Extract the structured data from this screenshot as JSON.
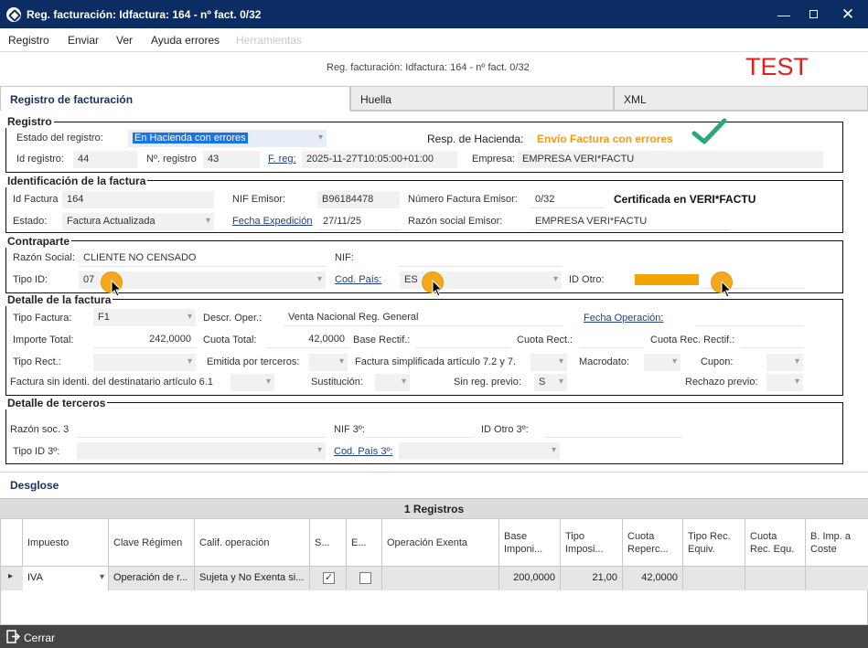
{
  "window": {
    "title": "Reg. facturación: Idfactura: 164 - nº fact. 0/32"
  },
  "menu": [
    "Registro",
    "Enviar",
    "Ver",
    "Ayuda errores",
    "Herramientas"
  ],
  "subtitle": "Reg. facturación: Idfactura: 164 - nº fact. 0/32",
  "env_label": "TEST",
  "tabs": [
    "Registro de facturación",
    "Huella",
    "XML"
  ],
  "registro": {
    "title": "Registro",
    "estado_label": "Estado del registro:",
    "estado_value": "En Hacienda con errores",
    "resp_label": "Resp. de Hacienda:",
    "resp_value": "Envío Factura con errores",
    "idreg_label": "Id registro:",
    "idreg_value": "44",
    "nreg_label": "Nº. registro",
    "nreg_value": "43",
    "freg_label": "F. reg:",
    "freg_value": "2025-11-27T10:05:00+01:00",
    "empresa_label": "Empresa:",
    "empresa_value": "EMPRESA VERI*FACTU"
  },
  "identificacion": {
    "title": "Identificación de la factura",
    "idfactura_label": "Id Factura",
    "idfactura_value": "164",
    "nif_label": "NIF Emisor:",
    "nif_value": "B96184478",
    "num_label": "Número Factura Emisor:",
    "num_value": "0/32",
    "cert_text": "Certificada en VERI*FACTU",
    "estado_label": "Estado:",
    "estado_value": "Factura Actualizada",
    "fexp_label": "Fecha Expedición",
    "fexp_value": "27/11/25",
    "razon_label": "Razón social Emisor:",
    "razon_value": "EMPRESA VERI*FACTU"
  },
  "contraparte": {
    "title": "Contraparte",
    "razon_label": "Razón Social:",
    "razon_value": "CLIENTE NO CENSADO",
    "nif_label": "NIF:",
    "nif_value": "",
    "tipoid_label": "Tipo ID:",
    "tipoid_value": "07",
    "codpais_label": "Cod. País:",
    "codpais_value": "ES",
    "idotro_label": "ID Otro:"
  },
  "detalle": {
    "title": "Detalle de la factura",
    "tipofac_label": "Tipo Factura:",
    "tipofac_value": "F1",
    "descr_label": "Descr. Oper.:",
    "descr_value": "Venta Nacional Reg. General",
    "fechaop_label": "Fecha Operación:",
    "importe_label": "Importe Total:",
    "importe_value": "242,0000",
    "cuota_label": "Cuota Total:",
    "cuota_value": "42,0000",
    "base_rect_label": "Base Rectif.:",
    "cuota_rect_label": "Cuota Rect.:",
    "cuota_rec_rect_label": "Cuota Rec. Rectif.:",
    "tiporect_label": "Tipo Rect.:",
    "emitida_label": "Emitida por terceros:",
    "simplif_label": "Factura simplificada artículo 7.2 y 7.",
    "macrodato_label": "Macrodato:",
    "cupon_label": "Cupon:",
    "sinident_label": "Factura sin identi. del destinatario artículo 6.1",
    "sustitucion_label": "Sustitución:",
    "sinreg_label": "Sin reg. previo:",
    "sinreg_value": "S",
    "rechazo_label": "Rechazo previo:"
  },
  "terceros": {
    "title": "Detalle de terceros",
    "razon_label": "Razón soc. 3",
    "nif_label": "NIF 3º:",
    "idotro_label": "ID Otro 3º:",
    "tipoid_label": "Tipo ID 3º:",
    "codpais_label": "Cod. País 3º:"
  },
  "desglose": {
    "title": "Desglose",
    "count": "1 Registros",
    "columns": [
      "Impuesto",
      "Clave Régimen",
      "Calif. operación",
      "S...",
      "E...",
      "Operación Exenta",
      "Base Imponi...",
      "Tipo Imposi...",
      "Cuota Reperc...",
      "Tipo Rec. Equiv.",
      "Cuota Rec. Equ.",
      "B. Imp. a Coste"
    ],
    "row": {
      "impuesto": "IVA",
      "clave": "Operación de r...",
      "calif": "Sujeta y No Exenta si...",
      "s": "✓",
      "e": "",
      "exenta": "",
      "base": "200,0000",
      "tipo": "21,00",
      "cuota": "42,0000",
      "tiporec": "",
      "cuotarec": "",
      "bimp": ""
    }
  },
  "footer": {
    "close_label": "Cerrar"
  },
  "colors": {
    "titlebar": "#0b2d64",
    "accent": "#f39c12",
    "test": "#e0201b",
    "check": "#2aa876"
  }
}
